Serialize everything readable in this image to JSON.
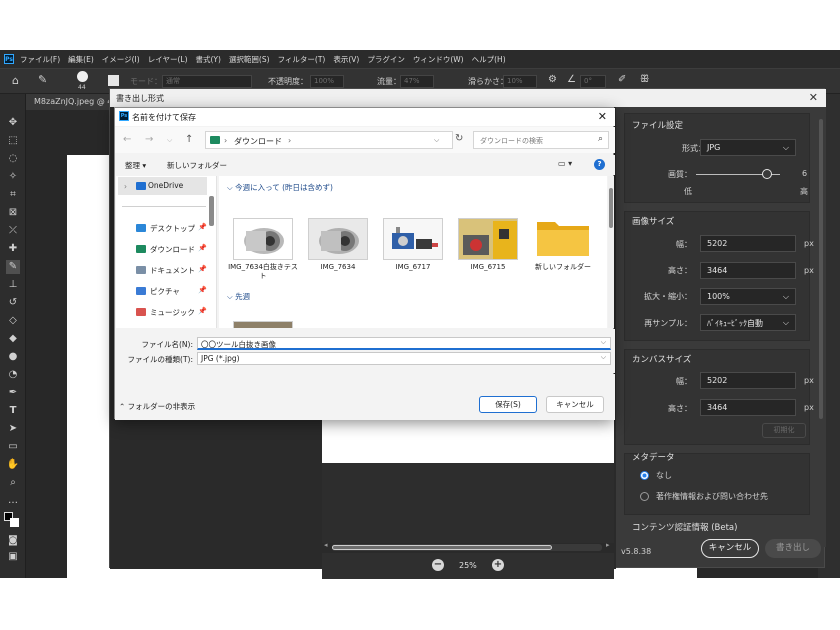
{
  "photoshop": {
    "logo": "Ps",
    "menu": [
      "ファイル(F)",
      "編集(E)",
      "イメージ(I)",
      "レイヤー(L)",
      "書式(Y)",
      "選択範囲(S)",
      "フィルター(T)",
      "表示(V)",
      "プラグイン",
      "ウィンドウ(W)",
      "ヘルプ(H)"
    ],
    "options": {
      "brush_size": "44",
      "mode_label": "モード：",
      "mode_value": "通常",
      "opacity_label": "不透明度：",
      "opacity_value": "100%",
      "flow_label": "流量：",
      "flow_value": "47%",
      "smoothing_label": "滑らかさ：",
      "smoothing_value": "10%",
      "angle_value": "0°"
    },
    "doc_tab": "M8zaZnJQ.jpeg @ 45"
  },
  "export_dialog": {
    "title": "書き出し形式",
    "file_settings": {
      "heading": "ファイル設定",
      "format_label": "形式：",
      "format_value": "JPG",
      "quality_label": "画質：",
      "quality_value": "6",
      "quality_fraction": 0.6,
      "low": "低",
      "high": "高"
    },
    "image_size": {
      "heading": "画像サイズ",
      "width_label": "幅：",
      "width_value": "5202",
      "height_label": "高さ：",
      "height_value": "3464",
      "unit": "px",
      "scale_label": "拡大・縮小：",
      "scale_value": "100%",
      "resample_label": "再サンプル：",
      "resample_value": "ﾊﾞｲｷｭｰﾋﾞｯｸ自動"
    },
    "canvas_size": {
      "heading": "カンバスサイズ",
      "width_label": "幅：",
      "width_value": "5202",
      "height_label": "高さ：",
      "height_value": "3464",
      "unit": "px",
      "reset": "初期化"
    },
    "metadata": {
      "heading": "メタデータ",
      "option_none": "なし",
      "option_copyright": "著作権情報および問い合わせ先"
    },
    "content_credentials": "コンテンツ認証情報 (Beta)",
    "zoom": "25%",
    "version": "v5.8.38",
    "cancel": "キャンセル",
    "export": "書き出し"
  },
  "save_dialog": {
    "title": "名前を付けて保存",
    "address": [
      "ダウンロード",
      "›"
    ],
    "search_placeholder": "ダウンロードの検索",
    "organize": "整理 ▾",
    "new_folder": "新しいフォルダー",
    "nav": {
      "onedrive": "OneDrive",
      "items": [
        "デスクトップ",
        "ダウンロード",
        "ドキュメント",
        "ピクチャ",
        "ミュージック"
      ]
    },
    "group_this_week": "今週に入って (昨日は含めず)",
    "group_last_week": "先週",
    "files": [
      "IMG_7634白抜きテスト",
      "IMG_7634",
      "IMG_6717",
      "IMG_6715",
      "新しいフォルダー"
    ],
    "filename_label": "ファイル名(N):",
    "filename_value": "〇〇ツール白抜き画像",
    "filetype_label": "ファイルの種類(T):",
    "filetype_value": "JPG (*.jpg)",
    "hide_folders": "フォルダーの非表示",
    "save": "保存(S)",
    "cancel": "キャンセル"
  },
  "colors": {
    "accent_blue": "#1f6fd1",
    "ps_dark": "#2b2b2b",
    "folder_yellow": "#f5c542"
  }
}
